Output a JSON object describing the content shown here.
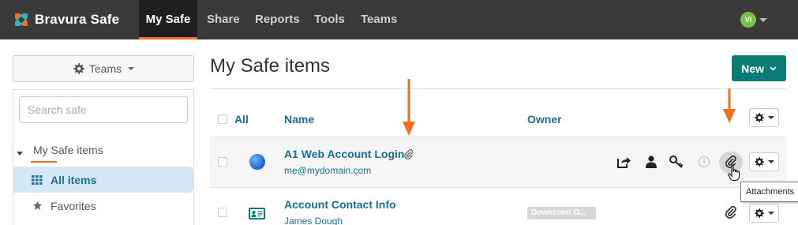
{
  "brand": {
    "name": "Bravura Safe"
  },
  "nav": {
    "tabs": [
      {
        "label": "My Safe",
        "active": true
      },
      {
        "label": "Share"
      },
      {
        "label": "Reports"
      },
      {
        "label": "Tools"
      },
      {
        "label": "Teams"
      }
    ],
    "user_initials": "VI"
  },
  "sidebar": {
    "teams_label": "Teams",
    "search_placeholder": "Search safe",
    "tree_root": "My Safe items",
    "items": [
      {
        "label": "All items",
        "icon": "grid-icon",
        "active": true
      },
      {
        "label": "Favorites",
        "icon": "star-icon"
      }
    ]
  },
  "main": {
    "title": "My Safe items",
    "new_label": "New",
    "columns": {
      "all": "All",
      "name": "Name",
      "owner": "Owner"
    },
    "rows": [
      {
        "title": "A1 Web Account Login",
        "subtitle": "me@mydomain.com",
        "icon": "globe-icon",
        "owner": ""
      },
      {
        "title": "Account Contact Info",
        "subtitle": "James Dough",
        "icon": "id-card-icon",
        "owner": "Downtown O..."
      }
    ],
    "tooltip": "Attachments"
  },
  "colors": {
    "accent": "#0a7c74",
    "link": "#1a6f8e",
    "nav_bg": "#3a3a3a",
    "orange": "#f26f21"
  }
}
